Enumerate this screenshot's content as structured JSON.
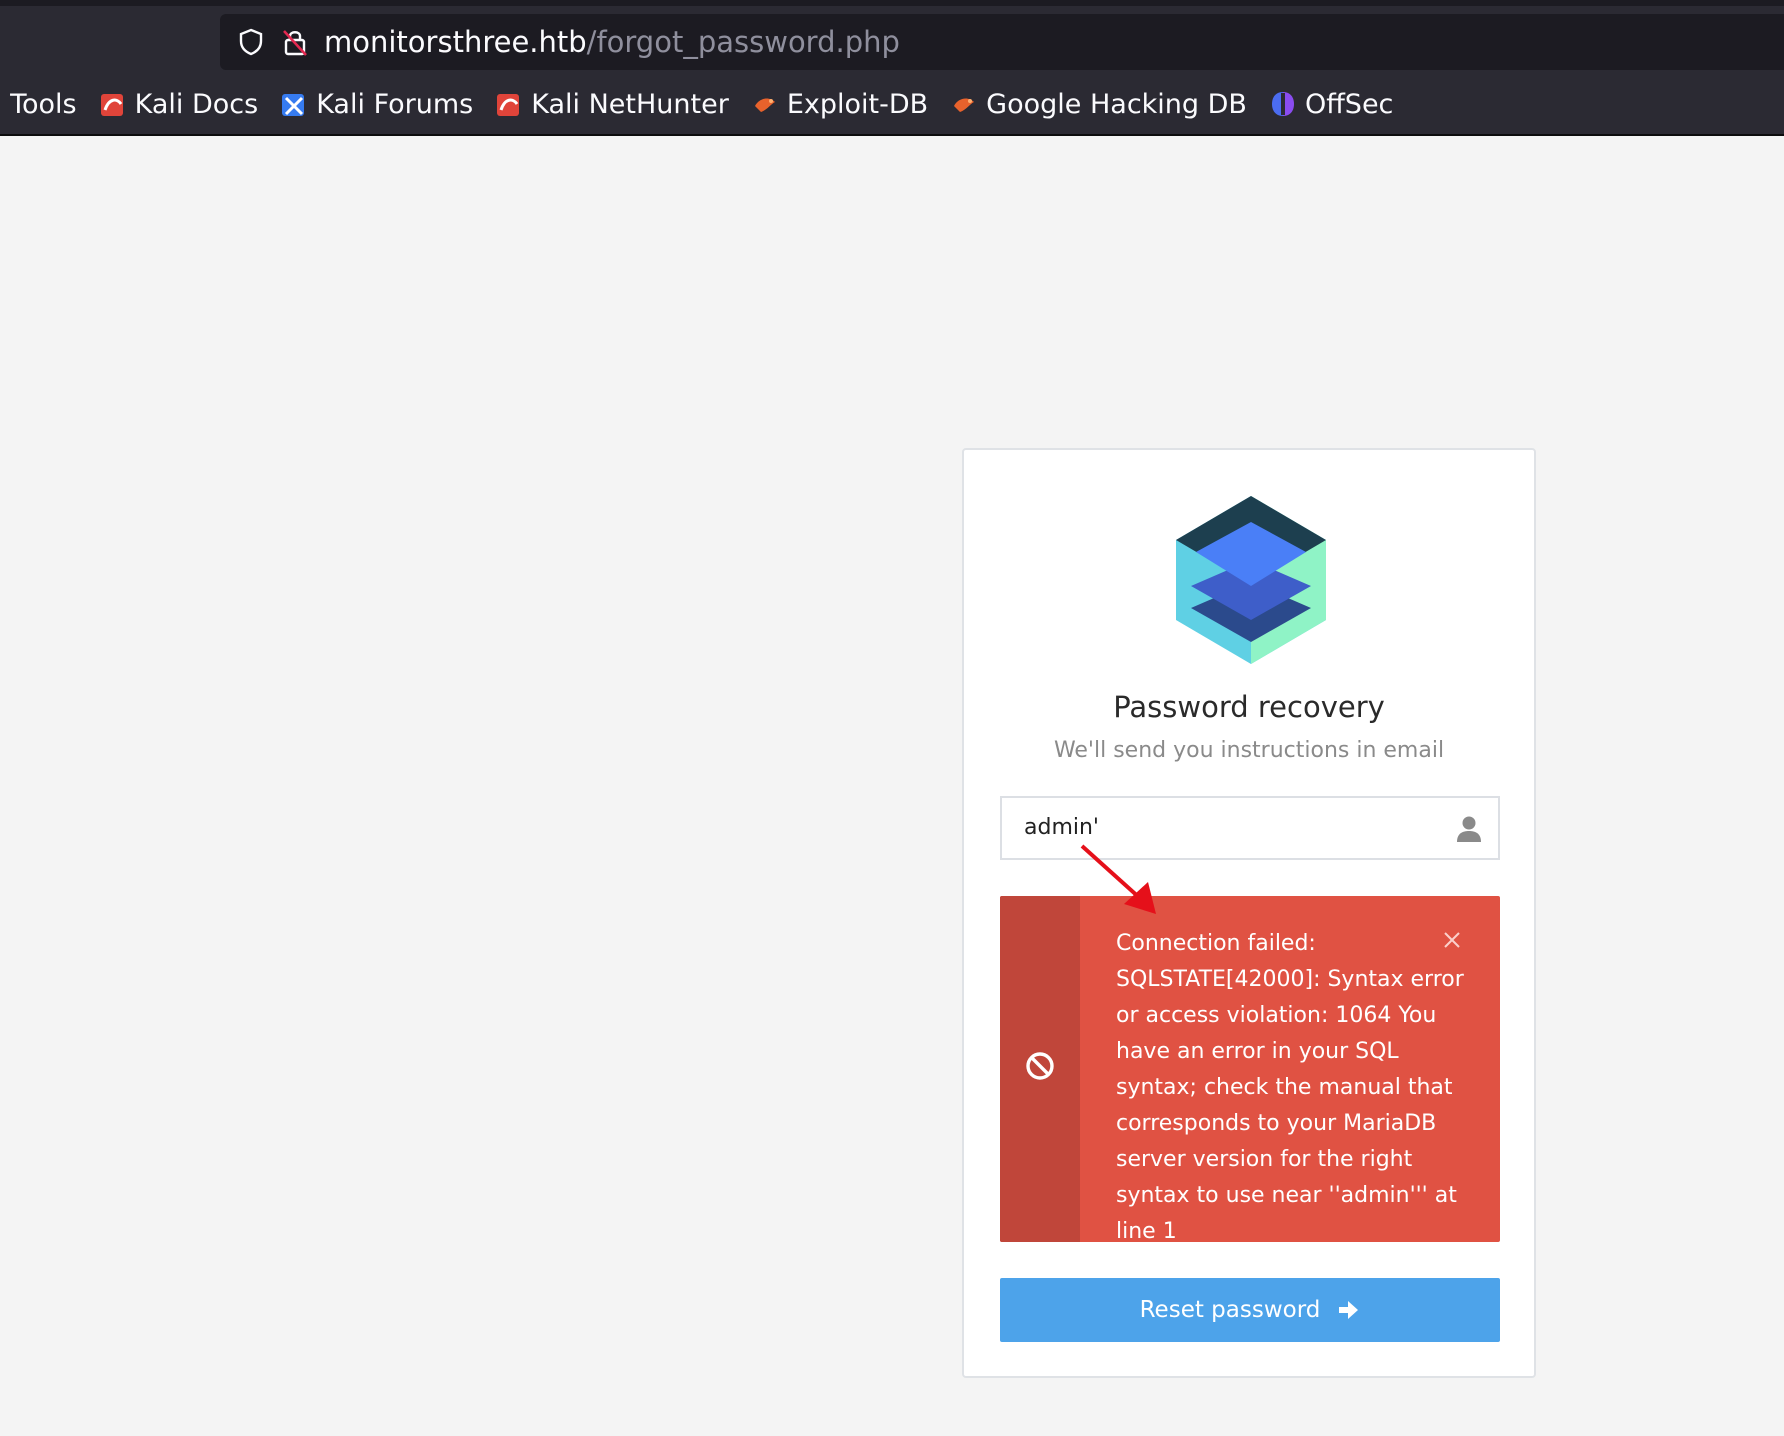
{
  "browser": {
    "url_host": "monitorsthree.htb",
    "url_path": "/forgot_password.php",
    "bookmarks": [
      {
        "label": "i Tools",
        "icon": "kali-icon"
      },
      {
        "label": "Kali Docs",
        "icon": "kali-docs-icon"
      },
      {
        "label": "Kali Forums",
        "icon": "kali-forums-icon"
      },
      {
        "label": "Kali NetHunter",
        "icon": "kali-nethunter-icon"
      },
      {
        "label": "Exploit-DB",
        "icon": "exploit-db-icon"
      },
      {
        "label": "Google Hacking DB",
        "icon": "ghdb-icon"
      },
      {
        "label": "OffSec",
        "icon": "offsec-icon"
      }
    ]
  },
  "form": {
    "title": "Password recovery",
    "subtitle": "We'll send you instructions in email",
    "input_value": "admin'",
    "error_message": "Connection failed: SQLSTATE[42000]: Syntax error or access violation: 1064 You have an error in your SQL syntax; check the manual that corresponds to your MariaDB server version for the right syntax to use near ''admin''' at line 1",
    "submit_label": "Reset password"
  },
  "colors": {
    "alert_bg": "#e05243",
    "alert_stripe": "#c0463a",
    "button_bg": "#4da3ea",
    "page_bg": "#f4f4f4"
  }
}
